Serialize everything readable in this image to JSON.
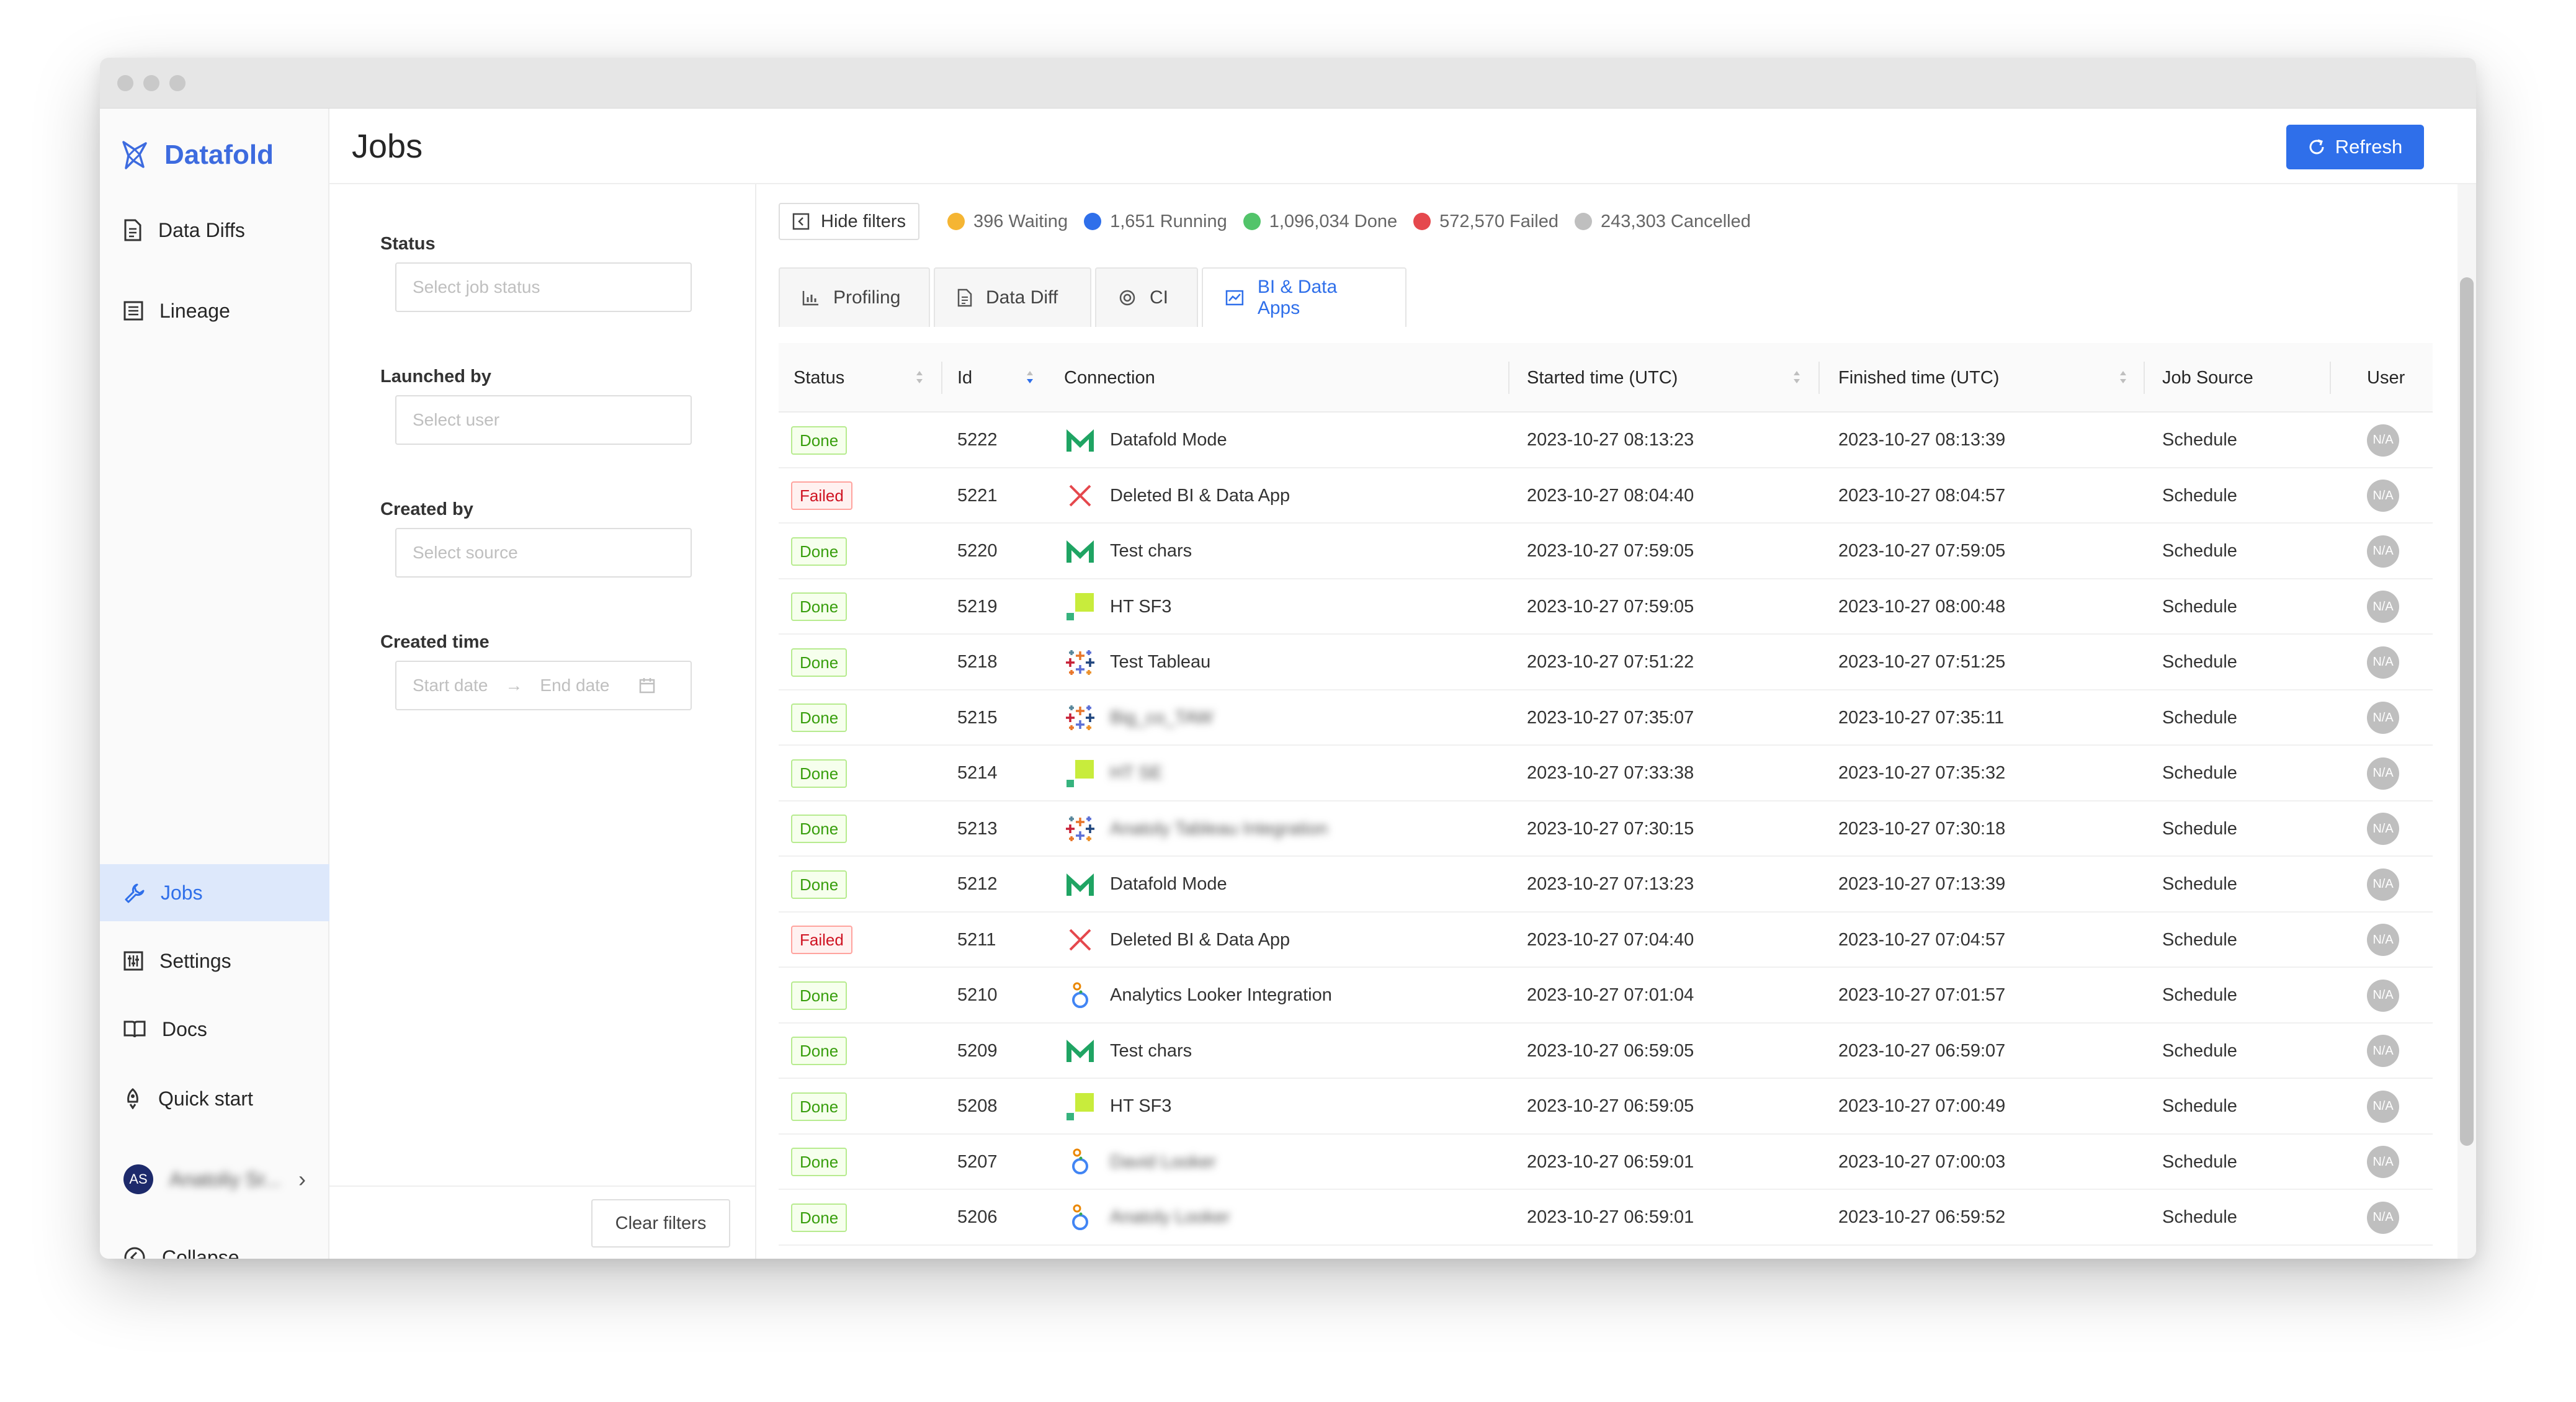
{
  "app": {
    "brand": "Datafold"
  },
  "sidebar": {
    "items": [
      {
        "label": "Data Diffs",
        "icon": "document-icon"
      },
      {
        "label": "Lineage",
        "icon": "list-icon"
      },
      {
        "label": "Jobs",
        "icon": "wrench-icon"
      },
      {
        "label": "Settings",
        "icon": "sliders-icon"
      },
      {
        "label": "Docs",
        "icon": "book-icon"
      },
      {
        "label": "Quick start",
        "icon": "rocket-icon"
      }
    ],
    "user": {
      "initials": "AS",
      "name": "Anatoliy Sr..."
    },
    "collapse_label": "Collapse"
  },
  "header": {
    "title": "Jobs",
    "refresh_label": "Refresh"
  },
  "filters": {
    "status_label": "Status",
    "status_placeholder": "Select job status",
    "launched_label": "Launched by",
    "launched_placeholder": "Select user",
    "created_by_label": "Created by",
    "created_by_placeholder": "Select source",
    "created_time_label": "Created time",
    "start_placeholder": "Start date",
    "end_placeholder": "End date",
    "clear_label": "Clear filters"
  },
  "toolbar": {
    "hide_filters_label": "Hide filters",
    "stats": [
      {
        "label": "396 Waiting",
        "color": "#f5b533"
      },
      {
        "label": "1,651 Running",
        "color": "#2f6fea"
      },
      {
        "label": "1,096,034 Done",
        "color": "#52c46a"
      },
      {
        "label": "572,570 Failed",
        "color": "#e5484d"
      },
      {
        "label": "243,303 Cancelled",
        "color": "#bfbfbf"
      }
    ]
  },
  "tabs": [
    {
      "label": "Profiling",
      "icon": "bar-chart-icon"
    },
    {
      "label": "Data Diff",
      "icon": "document-icon"
    },
    {
      "label": "CI",
      "icon": "target-icon"
    },
    {
      "label": "BI & Data Apps",
      "icon": "chart-window-icon",
      "active": true
    }
  ],
  "table": {
    "columns": [
      "Status",
      "Id",
      "Connection",
      "Started time (UTC)",
      "Finished time (UTC)",
      "Job Source",
      "User"
    ],
    "rows": [
      {
        "status": "Done",
        "id": "5222",
        "icon": "mode",
        "connection": "Datafold Mode",
        "started": "2023-10-27 08:13:23",
        "finished": "2023-10-27 08:13:39",
        "source": "Schedule",
        "user": "N/A"
      },
      {
        "status": "Failed",
        "id": "5221",
        "icon": "deleted",
        "connection": "Deleted BI & Data App",
        "started": "2023-10-27 08:04:40",
        "finished": "2023-10-27 08:04:57",
        "source": "Schedule",
        "user": "N/A"
      },
      {
        "status": "Done",
        "id": "5220",
        "icon": "mode",
        "connection": "Test chars",
        "started": "2023-10-27 07:59:05",
        "finished": "2023-10-27 07:59:05",
        "source": "Schedule",
        "user": "N/A"
      },
      {
        "status": "Done",
        "id": "5219",
        "icon": "hightouch",
        "connection": "HT SF3",
        "started": "2023-10-27 07:59:05",
        "finished": "2023-10-27 08:00:48",
        "source": "Schedule",
        "user": "N/A"
      },
      {
        "status": "Done",
        "id": "5218",
        "icon": "tableau",
        "connection": "Test Tableau",
        "started": "2023-10-27 07:51:22",
        "finished": "2023-10-27 07:51:25",
        "source": "Schedule",
        "user": "N/A"
      },
      {
        "status": "Done",
        "id": "5215",
        "icon": "tableau",
        "connection": "Big_co_TAW",
        "blurred": true,
        "started": "2023-10-27 07:35:07",
        "finished": "2023-10-27 07:35:11",
        "source": "Schedule",
        "user": "N/A"
      },
      {
        "status": "Done",
        "id": "5214",
        "icon": "hightouch",
        "connection": "HT SE",
        "blurred": true,
        "started": "2023-10-27 07:33:38",
        "finished": "2023-10-27 07:35:32",
        "source": "Schedule",
        "user": "N/A"
      },
      {
        "status": "Done",
        "id": "5213",
        "icon": "tableau",
        "connection": "Anatoly Tableau Integration",
        "blurred": true,
        "started": "2023-10-27 07:30:15",
        "finished": "2023-10-27 07:30:18",
        "source": "Schedule",
        "user": "N/A"
      },
      {
        "status": "Done",
        "id": "5212",
        "icon": "mode",
        "connection": "Datafold Mode",
        "started": "2023-10-27 07:13:23",
        "finished": "2023-10-27 07:13:39",
        "source": "Schedule",
        "user": "N/A"
      },
      {
        "status": "Failed",
        "id": "5211",
        "icon": "deleted",
        "connection": "Deleted BI & Data App",
        "started": "2023-10-27 07:04:40",
        "finished": "2023-10-27 07:04:57",
        "source": "Schedule",
        "user": "N/A"
      },
      {
        "status": "Done",
        "id": "5210",
        "icon": "looker",
        "connection": "Analytics Looker Integration",
        "started": "2023-10-27 07:01:04",
        "finished": "2023-10-27 07:01:57",
        "source": "Schedule",
        "user": "N/A"
      },
      {
        "status": "Done",
        "id": "5209",
        "icon": "mode",
        "connection": "Test chars",
        "started": "2023-10-27 06:59:05",
        "finished": "2023-10-27 06:59:07",
        "source": "Schedule",
        "user": "N/A"
      },
      {
        "status": "Done",
        "id": "5208",
        "icon": "hightouch",
        "connection": "HT SF3",
        "started": "2023-10-27 06:59:05",
        "finished": "2023-10-27 07:00:49",
        "source": "Schedule",
        "user": "N/A"
      },
      {
        "status": "Done",
        "id": "5207",
        "icon": "looker",
        "connection": "David Looker",
        "blurred": true,
        "started": "2023-10-27 06:59:01",
        "finished": "2023-10-27 07:00:03",
        "source": "Schedule",
        "user": "N/A"
      },
      {
        "status": "Done",
        "id": "5206",
        "icon": "looker",
        "connection": "Anatoly Looker",
        "blurred": true,
        "started": "2023-10-27 06:59:01",
        "finished": "2023-10-27 06:59:52",
        "source": "Schedule",
        "user": "N/A"
      }
    ]
  },
  "colors": {
    "accent": "#2f6fea",
    "brand": "#3d6bdf",
    "done": "#389e0d",
    "failed": "#cf1322"
  }
}
